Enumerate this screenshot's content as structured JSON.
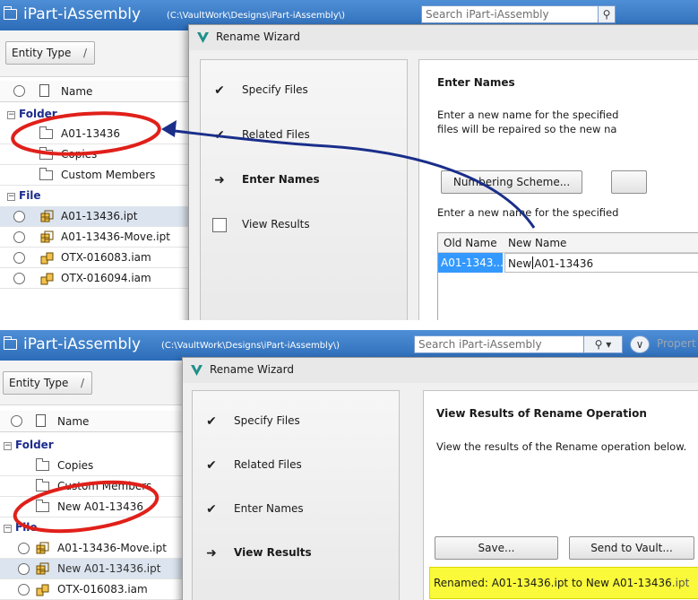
{
  "app": {
    "title": "iPart-iAssembly",
    "path_top": "(C:\\VaultWork\\Designs\\iPart-iAssembly\\)",
    "path_bottom": "(C:\\VaultWork\\Designs\\iPart-iAssembly\\)",
    "search_placeholder": "Search iPart-iAssembly",
    "properties_label": "Propert"
  },
  "left_panel": {
    "entity_type_label": "Entity Type",
    "entity_type_sep": "/",
    "name_column": "Name",
    "folder_group": "Folder",
    "file_group": "File",
    "top": {
      "folders": [
        "A01-13436",
        "Copies",
        "Custom Members"
      ],
      "files": [
        "A01-13436.ipt",
        "A01-13436-Move.ipt",
        "OTX-016083.iam",
        "OTX-016094.iam"
      ]
    },
    "bottom": {
      "folders": [
        "Copies",
        "Custom Members",
        "New A01-13436"
      ],
      "files": [
        "A01-13436-Move.ipt",
        "New A01-13436.ipt",
        "OTX-016083.iam"
      ]
    }
  },
  "wizard": {
    "title": "Rename Wizard",
    "steps": [
      "Specify Files",
      "Related Files",
      "Enter Names",
      "View Results"
    ],
    "top": {
      "heading": "Enter Names",
      "desc1": "Enter a new name for the specified",
      "desc2": "files will be repaired so the new na",
      "numbering_button": "Numbering Scheme...",
      "desc3": "Enter a new name for the specified",
      "col_old": "Old Name",
      "col_new": "New Name",
      "old_value": "A01-1343...",
      "new_prefix": "New",
      "new_value": "A01-13436"
    },
    "bottom": {
      "heading": "View Results of Rename Operation",
      "desc": "View the results of the Rename operation below.",
      "save_button": "Save...",
      "send_button": "Send to Vault...",
      "result_prefix": "Renamed: A01-13436.ipt to New A01-13436",
      "result_ext": ".ipt"
    }
  },
  "colors": {
    "title_bar": "#2c6cb8",
    "selection": "#3399ff",
    "highlight": "#fafa3a",
    "annotation_red": "#e0201a",
    "annotation_arrow": "#1a2e8a"
  }
}
